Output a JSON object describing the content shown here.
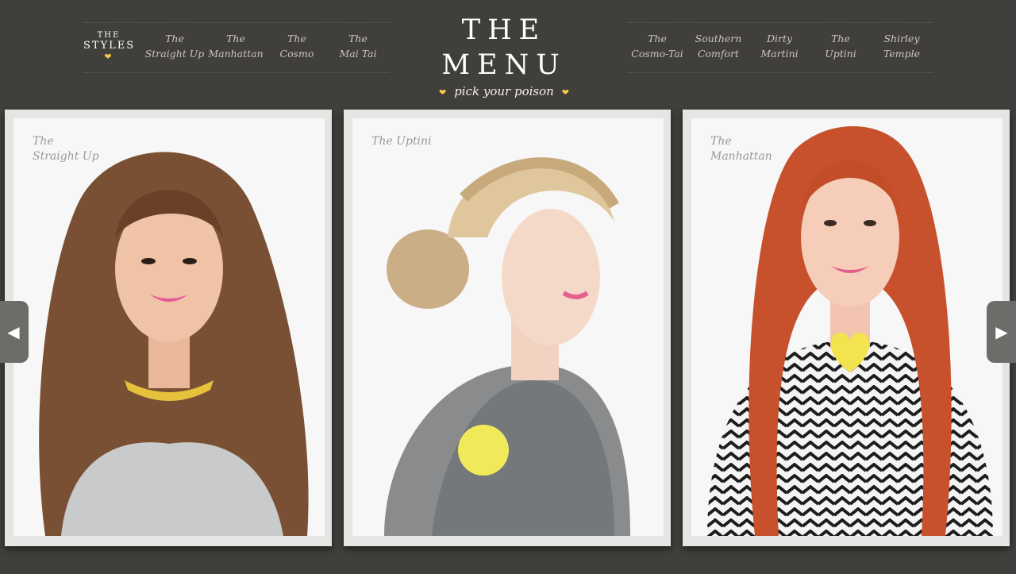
{
  "nav": {
    "logo": {
      "line1": "THE",
      "line2": "STYLES",
      "heart": "❤"
    },
    "left_items": [
      {
        "line1": "The",
        "line2": "Straight Up"
      },
      {
        "line1": "The",
        "line2": "Manhattan"
      },
      {
        "line1": "The",
        "line2": "Cosmo"
      },
      {
        "line1": "The",
        "line2": "Mai Tai"
      }
    ],
    "right_items": [
      {
        "line1": "The",
        "line2": "Cosmo-Tai"
      },
      {
        "line1": "Southern",
        "line2": "Comfort"
      },
      {
        "line1": "Dirty",
        "line2": "Martini"
      },
      {
        "line1": "The",
        "line2": "Uptini"
      },
      {
        "line1": "Shirley",
        "line2": "Temple"
      }
    ]
  },
  "brand": {
    "title": "THE MENU",
    "subtitle": "pick your poison",
    "heart": "❤"
  },
  "cards": [
    {
      "caption_line1": "The",
      "caption_line2": "Straight Up"
    },
    {
      "caption_line1": "The Uptini",
      "caption_line2": ""
    },
    {
      "caption_line1": "The",
      "caption_line2": "Manhattan"
    }
  ],
  "arrows": {
    "prev": "◀",
    "next": "▶"
  },
  "colors": {
    "background": "#403f3b",
    "accent_yellow": "#f6c94a",
    "nav_text": "#c9c6bd",
    "card_frame": "#e6e5e3"
  }
}
